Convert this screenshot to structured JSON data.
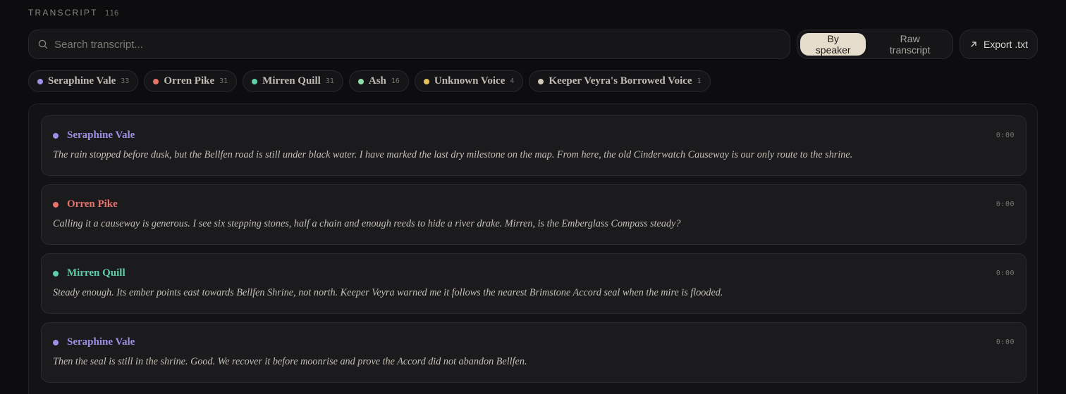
{
  "section": {
    "title": "TRANSCRIPT",
    "count": "116"
  },
  "search": {
    "placeholder": "Search transcript..."
  },
  "view_toggle": {
    "by_speaker": "By speaker",
    "raw": "Raw transcript",
    "active": "by_speaker"
  },
  "export": {
    "label": "Export .txt"
  },
  "colors": {
    "seraphine": "#9d8fe6",
    "orren": "#e9736b",
    "mirren": "#5fcfaa",
    "ash": "#8fe0a8",
    "unknown": "#e8c35a",
    "keeper": "#cfc8b6",
    "active_toggle_bg": "#e6dccb"
  },
  "speakers": [
    {
      "name": "Seraphine Vale",
      "count": "33",
      "color": "#9d8fe6"
    },
    {
      "name": "Orren Pike",
      "count": "31",
      "color": "#e9736b"
    },
    {
      "name": "Mirren Quill",
      "count": "31",
      "color": "#5fcfaa"
    },
    {
      "name": "Ash",
      "count": "16",
      "color": "#8fe0a8"
    },
    {
      "name": "Unknown Voice",
      "count": "4",
      "color": "#e8c35a"
    },
    {
      "name": "Keeper Veyra's Borrowed Voice",
      "count": "1",
      "color": "#cfc8b6"
    }
  ],
  "entries": [
    {
      "speaker": "Seraphine Vale",
      "color": "#9d8fe6",
      "time": "0:00",
      "text": "The rain stopped before dusk, but the Bellfen road is still under black water. I have marked the last dry milestone on the map. From here, the old Cinderwatch Causeway is our only route to the shrine."
    },
    {
      "speaker": "Orren Pike",
      "color": "#e9736b",
      "time": "0:00",
      "text": "Calling it a causeway is generous. I see six stepping stones, half a chain and enough reeds to hide a river drake. Mirren, is the Emberglass Compass steady?"
    },
    {
      "speaker": "Mirren Quill",
      "color": "#5fcfaa",
      "time": "0:00",
      "text": "Steady enough. Its ember points east towards Bellfen Shrine, not north. Keeper Veyra warned me it follows the nearest Brimstone Accord seal when the mire is flooded."
    },
    {
      "speaker": "Seraphine Vale",
      "color": "#9d8fe6",
      "time": "0:00",
      "text": "Then the seal is still in the shrine. Good. We recover it before moonrise and prove the Accord did not abandon Bellfen."
    }
  ]
}
